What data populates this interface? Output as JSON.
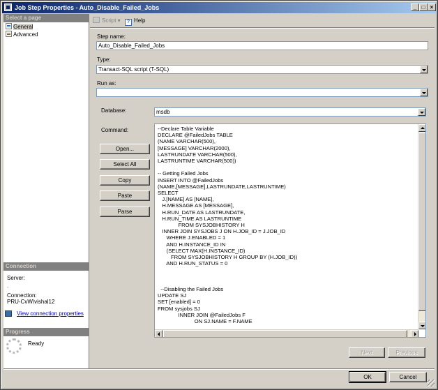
{
  "window": {
    "title": "Job Step Properties - Auto_Disable_Failed_Jobs",
    "controls": [
      "_",
      "□",
      "×"
    ]
  },
  "left_pane": {
    "select_page_header": "Select a page",
    "pages": [
      {
        "label": "General",
        "selected": true
      },
      {
        "label": "Advanced",
        "selected": false
      }
    ],
    "connection_header": "Connection",
    "server_label": "Server:",
    "server_value": ".",
    "connection_label": "Connection:",
    "connection_value": "PRU-CvW\\vishal12",
    "view_connection_link": "View connection properties",
    "progress_header": "Progress",
    "progress_status": "Ready"
  },
  "toolbar": {
    "script_label": "Script",
    "help_label": "Help"
  },
  "form": {
    "step_name_label": "Step name:",
    "step_name_value": "Auto_Disable_Failed_Jobs",
    "type_label": "Type:",
    "type_value": "Transact-SQL script (T-SQL)",
    "run_as_label": "Run as:",
    "run_as_value": "",
    "database_label": "Database:",
    "database_value": "msdb",
    "command_label": "Command:",
    "command_buttons": {
      "open": "Open...",
      "select_all": "Select All",
      "copy": "Copy",
      "paste": "Paste",
      "parse": "Parse"
    },
    "command_lines": [
      "--Declare Table Variable",
      "DECLARE @FailedJobs TABLE",
      "(NAME VARCHAR(500),",
      "[MESSAGE] VARCHAR(2000),",
      "LASTRUNDATE VARCHAR(500),",
      "LASTRUNTIME VARCHAR(500))",
      "",
      "-- Getting Failed Jobs",
      "INSERT INTO @FailedJobs",
      "(NAME,[MESSAGE],LASTRUNDATE,LASTRUNTIME)",
      "SELECT",
      "   J.[NAME] AS [NAME],",
      "   H.MESSAGE AS [MESSAGE],",
      "   H.RUN_DATE AS LASTRUNDATE,",
      "   H.RUN_TIME AS LASTRUNTIME",
      "              FROM SYSJOBHISTORY H",
      "   INNER JOIN SYSJOBS J ON H.JOB_ID = J.JOB_ID",
      "      WHERE J.ENABLED = 1",
      "      AND H.INSTANCE_ID IN",
      "      (SELECT MAX(H.INSTANCE_ID)",
      "         FROM SYSJOBHISTORY H GROUP BY (H.JOB_ID))",
      "      AND H.RUN_STATUS = 0",
      "",
      "",
      "",
      "  --Disabling the Failed Jobs",
      "UPDATE SJ",
      "SET [enabled] = 0",
      "FROM sysjobs SJ",
      "              INNER JOIN @FailedJobs F",
      "                         ON SJ.NAME = F.NAME"
    ]
  },
  "nav_buttons": {
    "next": "Next",
    "previous": "Previous"
  },
  "dialog_buttons": {
    "ok": "OK",
    "cancel": "Cancel"
  }
}
